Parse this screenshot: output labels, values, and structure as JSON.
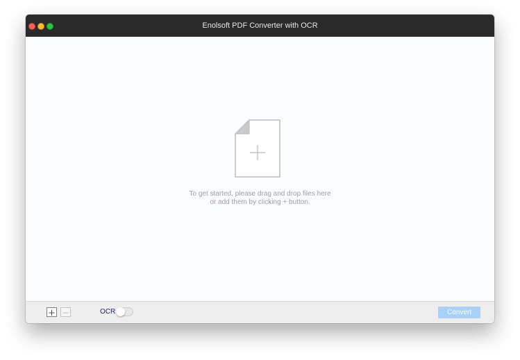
{
  "window": {
    "title": "Enolsoft PDF Converter with OCR"
  },
  "dropzone": {
    "icon": "add-file-icon",
    "hint_line1": "To get started, please drag and drop files here",
    "hint_line2": "or add them by clicking + button."
  },
  "toolbar": {
    "add_icon": "plus-icon",
    "remove_icon": "minus-icon",
    "ocr_label": "OCR",
    "ocr_enabled": false,
    "convert_label": "Convert",
    "convert_enabled": false
  },
  "colors": {
    "titlebar": "#2a2a2a",
    "convert_button": "#a9d0f6",
    "ocr_label": "#1c2a66",
    "hint_text": "#9a9ea6"
  }
}
